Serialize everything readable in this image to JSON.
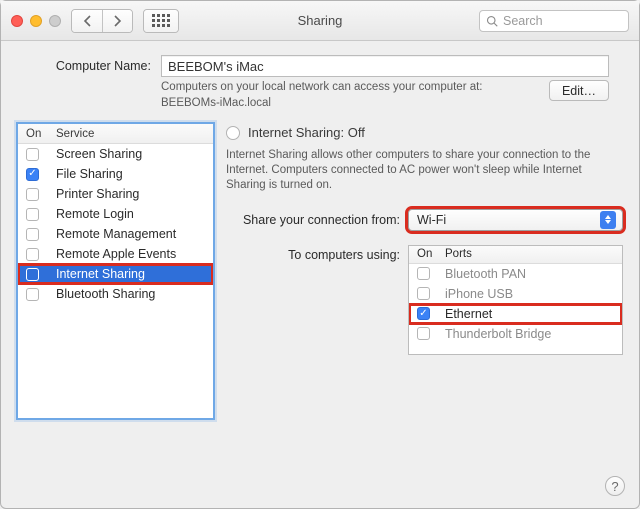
{
  "window": {
    "title": "Sharing",
    "search_placeholder": "Search"
  },
  "computer_name": {
    "label": "Computer Name:",
    "value": "BEEBOM's iMac",
    "subtext": "Computers on your local network can access your computer at: BEEBOMs-iMac.local",
    "edit_label": "Edit…"
  },
  "services": {
    "head_on": "On",
    "head_service": "Service",
    "items": [
      {
        "label": "Screen Sharing",
        "on": false
      },
      {
        "label": "File Sharing",
        "on": true
      },
      {
        "label": "Printer Sharing",
        "on": false
      },
      {
        "label": "Remote Login",
        "on": false
      },
      {
        "label": "Remote Management",
        "on": false
      },
      {
        "label": "Remote Apple Events",
        "on": false
      },
      {
        "label": "Internet Sharing",
        "on": false
      },
      {
        "label": "Bluetooth Sharing",
        "on": false
      }
    ],
    "selected_index": 6
  },
  "detail": {
    "title": "Internet Sharing: Off",
    "description": "Internet Sharing allows other computers to share your connection to the Internet. Computers connected to AC power won't sleep while Internet Sharing is turned on.",
    "share_from_label": "Share your connection from:",
    "share_from_value": "Wi-Fi",
    "to_label": "To computers using:",
    "ports_head_on": "On",
    "ports_head_ports": "Ports",
    "ports": [
      {
        "label": "Bluetooth PAN",
        "on": false
      },
      {
        "label": "iPhone USB",
        "on": false
      },
      {
        "label": "Ethernet",
        "on": true
      },
      {
        "label": "Thunderbolt Bridge",
        "on": false
      }
    ]
  },
  "help_label": "?"
}
